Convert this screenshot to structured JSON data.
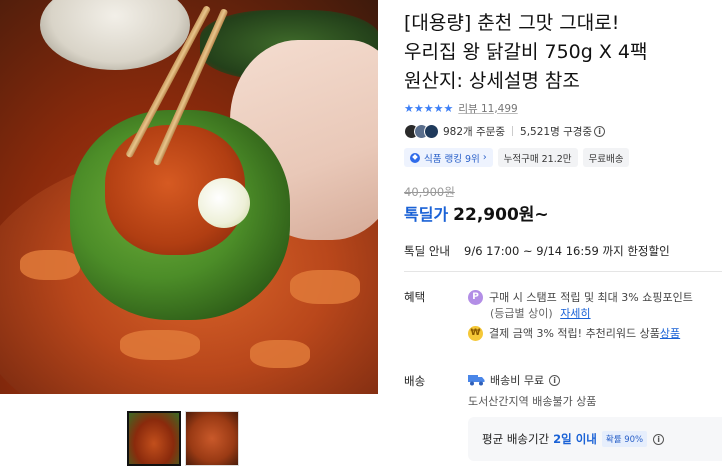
{
  "product": {
    "title_line1": "[대용량] 춘천 그맛 그대로!",
    "title_line2": "우리집 왕 닭갈비 750g X 4팩",
    "title_line3": "원산지: 상세설명 참조",
    "rating": 5,
    "review_text": "리뷰 11,499",
    "orders": "982개 주문중",
    "viewers": "5,521명 구경중",
    "rank_chip": "식품 랭킹 9위",
    "cumulative_chip": "누적구매 21.2만",
    "free_ship_chip": "무료배송",
    "original_price": "40,900원",
    "sale_label": "톡딜가",
    "sale_price": "22,900원~",
    "deal_label": "톡딜 안내",
    "deal_text": "9/6 17:00 ~ 9/14 16:59 까지 한정할인"
  },
  "benefits": {
    "label": "혜택",
    "stamp_text": "구매 시 스탬프 적립 및 최대 3% 쇼핑포인트",
    "stamp_sub": "(등급별 상이)",
    "stamp_link": "자세히",
    "pay_text": "결제 금액 3% 적립! 추천리워드 상품 ",
    "pay_link": "상품"
  },
  "shipping": {
    "label": "배송",
    "fee": "배송비 무료",
    "note": "도서산간지역 배송불가 상품",
    "avg_label": "평균 배송기간",
    "avg_value": "2일 이내",
    "avg_pct": "확률 90%"
  },
  "icons": {
    "info": "i",
    "point": "P",
    "coin": "₩"
  },
  "colors": {
    "accent": "#1a62d6",
    "star": "#3d7ff6"
  }
}
